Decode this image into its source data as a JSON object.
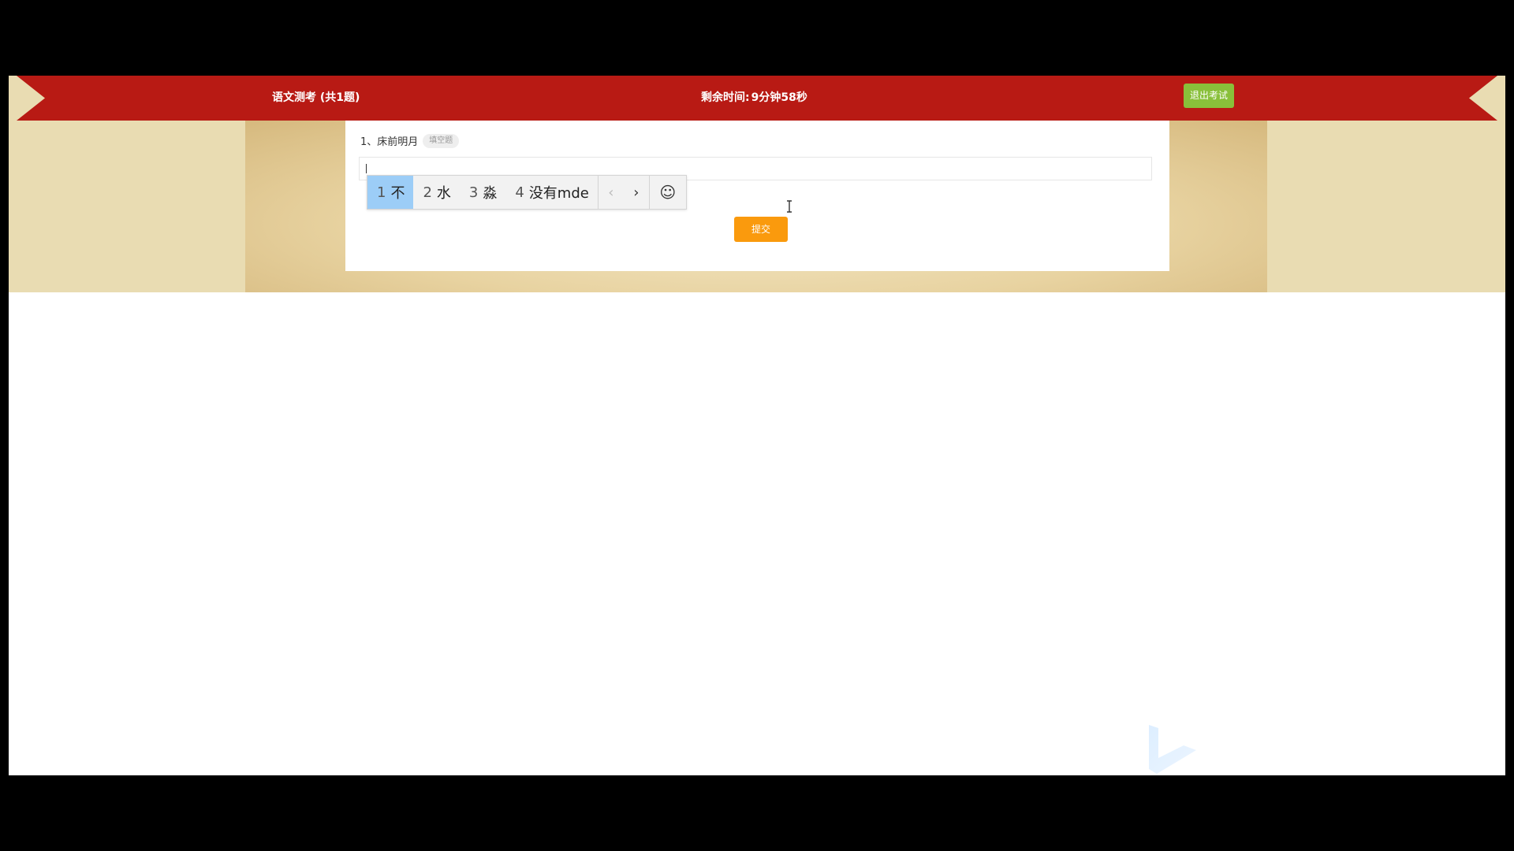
{
  "header": {
    "exam_title": "语文测考 (共1题)",
    "timer_label": "剩余时间:",
    "timer_value": "9分钟58秒",
    "exit_label": "退出考试"
  },
  "question": {
    "text": "1、床前明月",
    "type_badge": "填空题",
    "answer_value": "",
    "submit_label": "提交"
  },
  "ime": {
    "candidates": [
      {
        "num": "1",
        "text": "不"
      },
      {
        "num": "2",
        "text": "水"
      },
      {
        "num": "3",
        "text": "淼"
      },
      {
        "num": "4",
        "text": "没有mde"
      }
    ],
    "prev_icon": "‹",
    "next_icon": "›",
    "emoji_icon": "☺"
  },
  "colors": {
    "header_bg": "#b81a14",
    "exit_button": "#89c03a",
    "submit_button": "#fa9a0d",
    "ime_selected": "#9ccdf7",
    "band_bg": "#e9dcb2"
  }
}
